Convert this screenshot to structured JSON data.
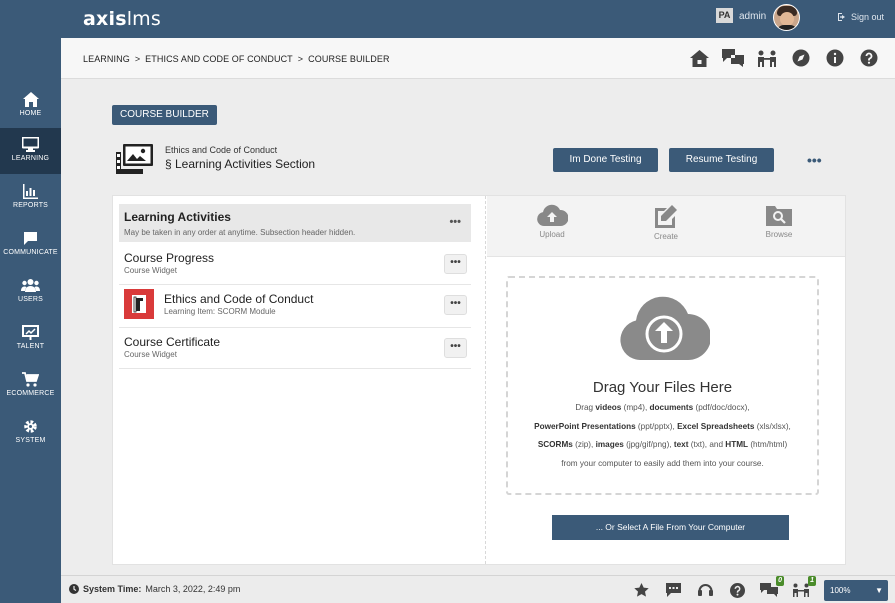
{
  "app": {
    "logo_bold": "axis",
    "logo_rest": "lms",
    "user_badge": "PA",
    "user_name": "admin",
    "signout_label": "Sign out"
  },
  "sidebar": {
    "items": [
      {
        "label": "HOME",
        "icon": "home-icon"
      },
      {
        "label": "LEARNING",
        "icon": "monitor-icon",
        "active": true
      },
      {
        "label": "REPORTS",
        "icon": "bar-chart-icon"
      },
      {
        "label": "COMMUNICATE",
        "icon": "chat-bubble-icon"
      },
      {
        "label": "USERS",
        "icon": "users-icon"
      },
      {
        "label": "TALENT",
        "icon": "presentation-icon"
      },
      {
        "label": "ECOMMERCE",
        "icon": "cart-icon"
      },
      {
        "label": "SYSTEM",
        "icon": "gear-icon"
      }
    ]
  },
  "breadcrumb": {
    "items": [
      "LEARNING",
      "ETHICS AND CODE OF CONDUCT",
      "COURSE BUILDER"
    ],
    "separator": ">"
  },
  "top_icons": [
    "house-icon",
    "chat-icon",
    "people-icon",
    "compass-icon",
    "info-icon",
    "help-icon"
  ],
  "course": {
    "tag": "COURSE BUILDER",
    "parent": "Ethics and Code of Conduct",
    "section": "§ Learning Activities Section",
    "done_button": "Im Done Testing",
    "resume_button": "Resume Testing",
    "more_dots": "•••"
  },
  "activities": {
    "header_title": "Learning Activities",
    "header_sub": "May be taken in any order at anytime. Subsection header hidden.",
    "header_dots": "•••",
    "items": [
      {
        "title": "Course Progress",
        "sub": "Course Widget"
      },
      {
        "title": "Ethics and Code of Conduct",
        "sub_label": "Learning Item:",
        "sub": "SCORM Module"
      },
      {
        "title": "Course Certificate",
        "sub": "Course Widget"
      }
    ],
    "item_dots": "•••"
  },
  "tools": {
    "upload": "Upload",
    "create": "Create",
    "browse": "Browse"
  },
  "dropzone": {
    "title": "Drag Your Files Here",
    "line1": {
      "p1": "Drag ",
      "b1": "videos",
      "p2": " (mp4), ",
      "b2": "documents",
      "p3": " (pdf/doc/docx),"
    },
    "line2": {
      "b1": "PowerPoint Presentations",
      "p1": " (ppt/pptx), ",
      "b2": "Excel Spreadsheets",
      "p2": " (xls/xlsx),"
    },
    "line3": {
      "b1": "SCORMs",
      "p1": " (zip), ",
      "b2": "images",
      "p2": " (jpg/gif/png), ",
      "b3": "text",
      "p3": " (txt), and ",
      "b4": "HTML",
      "p4": " (htm/html)"
    },
    "line4": "from your computer to easily add them into your course.",
    "select_button": "... Or Select A File From Your Computer"
  },
  "footer": {
    "system_time_label": "System Time:",
    "system_time_value": "March 3, 2022, 2:49 pm",
    "chat_badge": "0",
    "people_badge": "1",
    "zoom": "100%"
  },
  "colors": {
    "primary": "#3b5a78",
    "sidebar_active": "#22384e",
    "badge_green": "#4a8c2a",
    "scorm_red": "#d93a3a"
  }
}
